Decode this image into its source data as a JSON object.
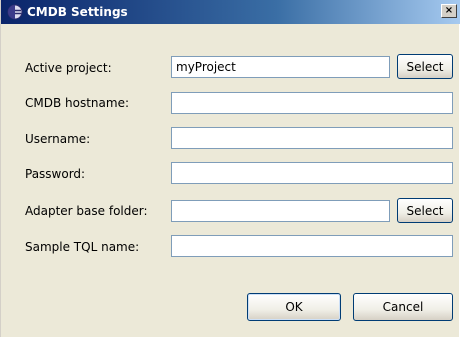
{
  "window": {
    "title": "CMDB Settings",
    "close_label": "×"
  },
  "form": {
    "active_project": {
      "label": "Active project:",
      "value": "myProject",
      "button_label": "Select"
    },
    "cmdb_hostname": {
      "label": "CMDB hostname:",
      "value": ""
    },
    "username": {
      "label": "Username:",
      "value": ""
    },
    "password": {
      "label": "Password:",
      "value": ""
    },
    "adapter_base_folder": {
      "label": "Adapter base folder:",
      "value": "",
      "button_label": "Select"
    },
    "sample_tql_name": {
      "label": "Sample TQL name:",
      "value": ""
    }
  },
  "footer": {
    "ok_label": "OK",
    "cancel_label": "Cancel"
  },
  "icons": {
    "title": "eclipse-app-icon",
    "close": "close-icon"
  },
  "colors": {
    "titlebar_start": "#0a246a",
    "titlebar_end": "#a6caf0",
    "dialog_background": "#ece9d8",
    "field_border": "#7f9db9",
    "button_border": "#003c74"
  }
}
